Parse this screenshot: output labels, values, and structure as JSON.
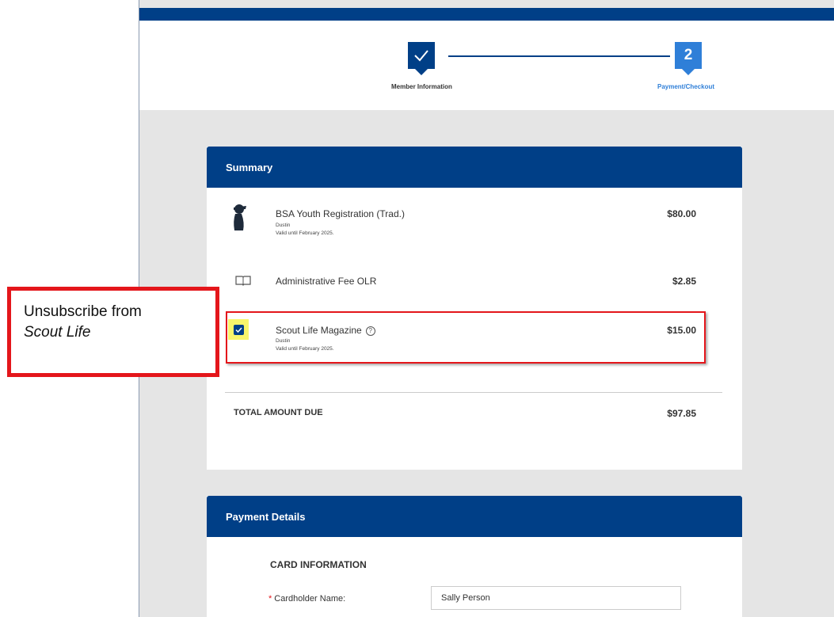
{
  "stepper": {
    "steps": [
      {
        "number": "",
        "label": "Member Information",
        "state": "done",
        "icon": "check-icon"
      },
      {
        "number": "2",
        "label": "Payment/Checkout",
        "state": "current"
      }
    ]
  },
  "summary": {
    "header": "Summary",
    "items": [
      {
        "icon": "scout-silhouette-icon",
        "title": "BSA Youth Registration (Trad.)",
        "name": "Dustin",
        "valid": "Valid until February 2025.",
        "price": "$80.00"
      },
      {
        "icon": "book-icon",
        "title": "Administrative Fee OLR",
        "price": "$2.85"
      },
      {
        "icon": "checkbox-checked-icon",
        "title": "Scout Life Magazine",
        "name": "Dustin",
        "valid": "Valid until February 2025.",
        "price": "$15.00",
        "help_icon": "help-circle-icon",
        "checked": true
      }
    ],
    "total_label": "TOTAL AMOUNT DUE",
    "total_value": "$97.85"
  },
  "payment": {
    "header": "Payment Details",
    "section_title": "CARD INFORMATION",
    "cardholder_label": "Cardholder Name:",
    "cardholder_value": "Sally Person"
  },
  "callout": {
    "line1": "Unsubscribe from",
    "line2": "Scout Life"
  },
  "colors": {
    "primary": "#003f87",
    "accent": "#2f7fd8",
    "highlight": "#e4161b",
    "checkbox_highlight": "#f8f56b"
  }
}
